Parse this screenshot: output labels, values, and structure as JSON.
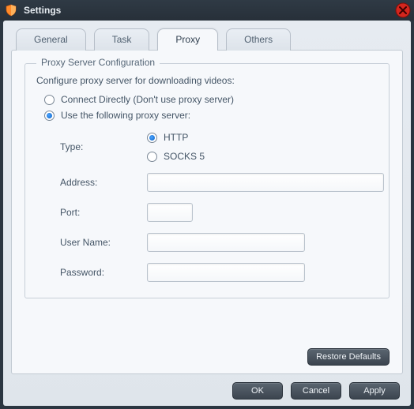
{
  "window": {
    "title": "Settings"
  },
  "tabs": {
    "general": "General",
    "task": "Task",
    "proxy": "Proxy",
    "others": "Others"
  },
  "proxy": {
    "legend": "Proxy Server Configuration",
    "desc": "Configure proxy server for downloading videos:",
    "mode": {
      "direct_label": "Connect Directly (Don't use proxy server)",
      "use_label": "Use the following proxy server:",
      "selected": "use"
    },
    "type": {
      "label": "Type:",
      "http_label": "HTTP",
      "socks5_label": "SOCKS 5",
      "selected": "http"
    },
    "address": {
      "label": "Address:",
      "value": ""
    },
    "port": {
      "label": "Port:",
      "value": ""
    },
    "username": {
      "label": "User Name:",
      "value": ""
    },
    "password": {
      "label": "Password:",
      "value": ""
    }
  },
  "buttons": {
    "restore": "Restore Defaults",
    "ok": "OK",
    "cancel": "Cancel",
    "apply": "Apply"
  }
}
